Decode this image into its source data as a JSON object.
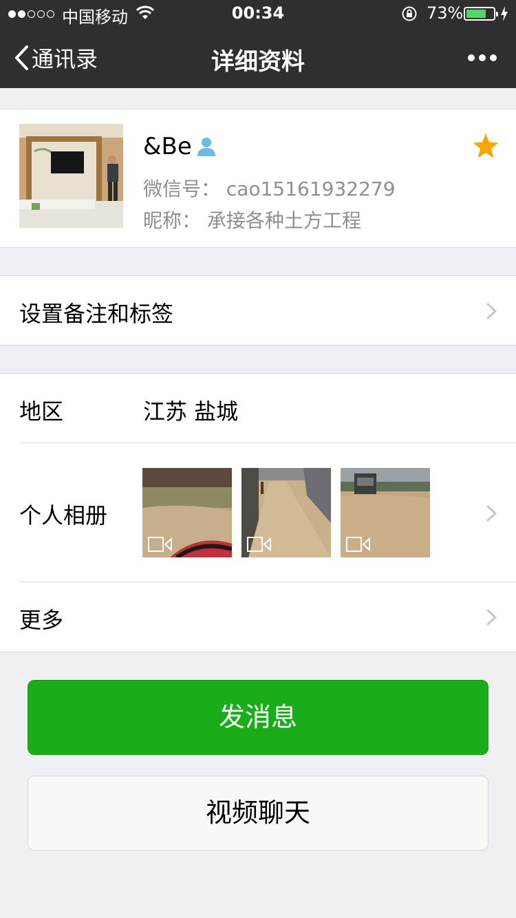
{
  "status_bar": {
    "carrier": "中国移动",
    "time": "00:34",
    "battery_percent": "73%",
    "battery_level": 0.73
  },
  "nav": {
    "back_label": "通讯录",
    "title": "详细资料"
  },
  "profile": {
    "name": "&Be",
    "wechat_id": "微信号： cao15161932279",
    "nickname": "昵称： 承接各种土方工程",
    "star_color": "#f7a600"
  },
  "remark": {
    "label": "设置备注和标签"
  },
  "info": {
    "region_label": "地区",
    "region_value": "江苏 盐城",
    "album_label": "个人相册",
    "more_label": "更多"
  },
  "buttons": {
    "send_message": "发消息",
    "video_call": "视频聊天"
  },
  "colors": {
    "primary_green": "#1aad19",
    "nav_bg": "#2e2e33",
    "page_bg": "#efeff4"
  }
}
